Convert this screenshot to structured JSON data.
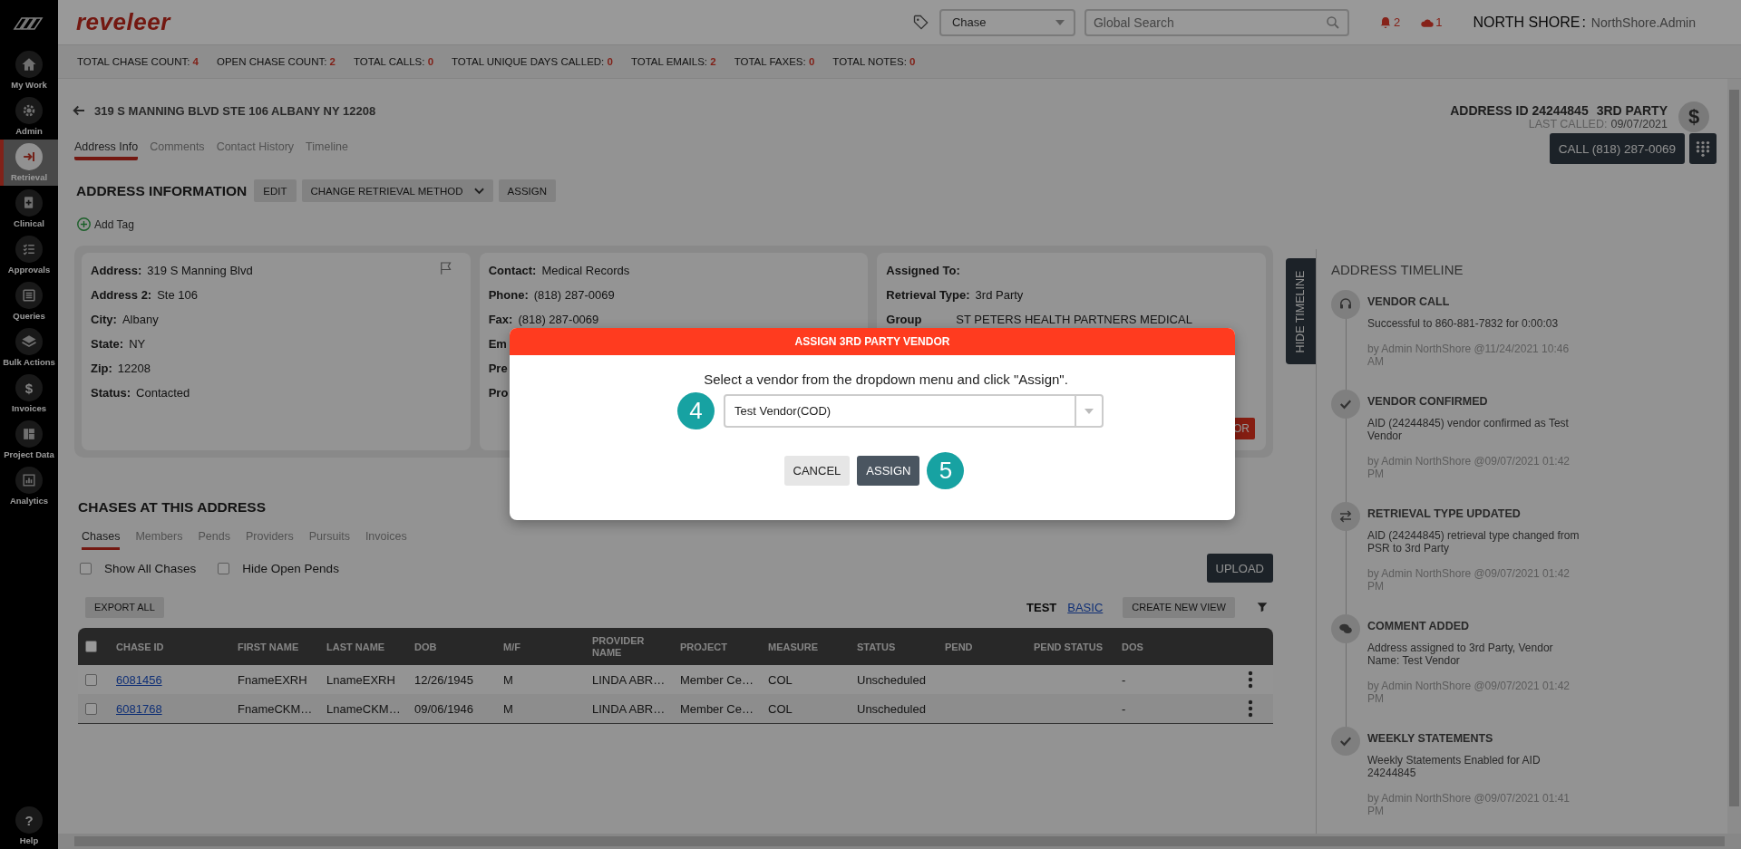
{
  "sidebar": {
    "items": [
      {
        "label": "My Work",
        "selected": false
      },
      {
        "label": "Admin",
        "selected": false
      },
      {
        "label": "Retrieval",
        "selected": true
      },
      {
        "label": "Clinical",
        "selected": false
      },
      {
        "label": "Approvals",
        "selected": false
      },
      {
        "label": "Queries",
        "selected": false
      },
      {
        "label": "Bulk Actions",
        "selected": false
      },
      {
        "label": "Invoices",
        "glyph": "$",
        "selected": false
      },
      {
        "label": "Project Data",
        "selected": false
      },
      {
        "label": "Analytics",
        "selected": false
      }
    ],
    "help": {
      "label": "Help",
      "glyph": "?"
    }
  },
  "topbar": {
    "logo": "reveleer",
    "search_type": "Chase",
    "search": {
      "placeholder": "Global Search"
    },
    "notifications": "2",
    "alerts": "1",
    "org": "NORTH SHORE",
    "separator": ":",
    "user": "NorthShore.Admin"
  },
  "stats": [
    {
      "label": "TOTAL CHASE COUNT:",
      "value": "4"
    },
    {
      "label": "OPEN CHASE COUNT:",
      "value": "2"
    },
    {
      "label": "TOTAL CALLS:",
      "value": "0"
    },
    {
      "label": "TOTAL UNIQUE DAYS CALLED:",
      "value": "0"
    },
    {
      "label": "TOTAL EMAILS:",
      "value": "2"
    },
    {
      "label": "TOTAL FAXES:",
      "value": "0"
    },
    {
      "label": "TOTAL NOTES:",
      "value": "0"
    }
  ],
  "address_header": {
    "address": "319 S MANNING BLVD STE 106 ALBANY NY 12208",
    "address_id": "ADDRESS ID 24244845",
    "party": "3RD PARTY",
    "last_called_label": "LAST CALLED:",
    "last_called": "09/07/2021",
    "billing_glyph": "$"
  },
  "tabs": [
    {
      "label": "Address Info",
      "selected": true
    },
    {
      "label": "Comments",
      "selected": false
    },
    {
      "label": "Contact History",
      "selected": false
    },
    {
      "label": "Timeline",
      "selected": false
    }
  ],
  "address_info": {
    "title": "ADDRESS INFORMATION",
    "buttons": [
      {
        "label": "EDIT",
        "kind": "plain"
      },
      {
        "label": "CHANGE RETRIEVAL METHOD",
        "kind": "dropdown"
      },
      {
        "label": "ASSIGN",
        "kind": "plain"
      }
    ],
    "add_tag": "Add Tag",
    "call_button": "CALL (818) 287-0069"
  },
  "cards": [
    {
      "flag": true,
      "fields": [
        {
          "label": "Address:",
          "value": "319 S Manning Blvd"
        },
        {
          "label": "Address 2:",
          "value": "Ste 106"
        },
        {
          "label": "City:",
          "value": "Albany"
        },
        {
          "label": "State:",
          "value": "NY"
        },
        {
          "label": "Zip:",
          "value": "12208"
        },
        {
          "label": "Status:",
          "value": "Contacted"
        }
      ]
    },
    {
      "flag": false,
      "fields": [
        {
          "label": "Contact:",
          "value": "Medical Records"
        },
        {
          "label": "Phone:",
          "value": "(818) 287-0069"
        },
        {
          "label": "Fax:",
          "value": "(818) 287-0069"
        },
        {
          "label": "Em"
        },
        {
          "label": "Pre"
        },
        {
          "label": "Pro"
        }
      ]
    },
    {
      "flag": false,
      "fields": [
        {
          "label": "Assigned To:"
        },
        {
          "label": "Retrieval Type:",
          "value": "3rd Party"
        },
        {
          "label": "Group",
          "value": "ST PETERS HEALTH PARTNERS MEDICAL"
        }
      ],
      "action": "OR"
    }
  ],
  "chases": {
    "title": "CHASES AT THIS ADDRESS",
    "tabs": [
      {
        "label": "Chases",
        "selected": true
      },
      {
        "label": "Members",
        "selected": false
      },
      {
        "label": "Pends",
        "selected": false
      },
      {
        "label": "Providers",
        "selected": false
      },
      {
        "label": "Pursuits",
        "selected": false
      },
      {
        "label": "Invoices",
        "selected": false
      }
    ],
    "filters": [
      {
        "label": "Show All Chases",
        "checked": false
      },
      {
        "label": "Hide Open Pends",
        "checked": false
      }
    ],
    "upload": "UPLOAD",
    "export": "EXPORT ALL",
    "views": [
      {
        "label": "TEST",
        "kind": "current"
      },
      {
        "label": "BASIC",
        "kind": "link"
      }
    ],
    "create_view": "CREATE NEW VIEW"
  },
  "table": {
    "header_checked": false,
    "columns": [
      "CHASE ID",
      "FIRST NAME",
      "LAST NAME",
      "DOB",
      "M/F",
      "PROVIDER NAME",
      "PROJECT",
      "MEASURE",
      "STATUS",
      "PEND",
      "PEND STATUS",
      "DOS"
    ],
    "rows": [
      {
        "checked": false,
        "cells": [
          "6081456",
          "FnameEXRH",
          "LnameEXRH",
          "12/26/1945",
          "M",
          "LINDA ABR…",
          "Member Ce…",
          "COL",
          "Unscheduled",
          "",
          "",
          "-"
        ]
      },
      {
        "checked": false,
        "cells": [
          "6081768",
          "FnameCKM…",
          "LnameCKM…",
          "09/06/1946",
          "M",
          "LINDA ABR…",
          "Member Ce…",
          "COL",
          "Unscheduled",
          "",
          "",
          "-"
        ]
      }
    ]
  },
  "timeline": {
    "hide_label": "HIDE TIMELINE",
    "title": "ADDRESS TIMELINE",
    "entries": [
      {
        "kind": "headset",
        "title": "VENDOR CALL",
        "text": "Successful to 860-881-7832 for 0:00:03",
        "by": "by Admin NorthShore @11/24/2021 10:46 AM"
      },
      {
        "kind": "check",
        "title": "VENDOR CONFIRMED",
        "text": "AID (24244845) vendor confirmed as Test Vendor",
        "by": "by Admin NorthShore @09/07/2021 01:42 PM"
      },
      {
        "kind": "swap",
        "title": "RETRIEVAL TYPE UPDATED",
        "text": "AID (24244845) retrieval type changed from PSR to 3rd Party",
        "by": "by Admin NorthShore @09/07/2021 01:42 PM"
      },
      {
        "kind": "comment",
        "title": "COMMENT ADDED",
        "text": "Address assigned to 3rd Party, Vendor Name: Test Vendor",
        "by": "by Admin NorthShore @09/07/2021 01:42 PM"
      },
      {
        "kind": "check",
        "title": "WEEKLY STATEMENTS",
        "text": "Weekly Statements Enabled for AID 24244845",
        "by": "by Admin NorthShore @09/07/2021 01:41 PM"
      }
    ]
  },
  "modal": {
    "title": "ASSIGN 3RD PARTY VENDOR",
    "message": "Select a vendor from the dropdown menu and click \"Assign\".",
    "select_step": "4",
    "vendor": "Test Vendor(COD)",
    "cancel": "CANCEL",
    "assign": "ASSIGN",
    "assign_step": "5"
  }
}
